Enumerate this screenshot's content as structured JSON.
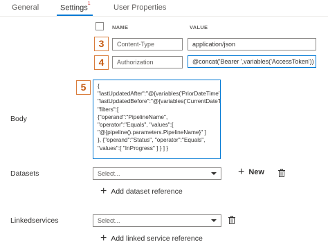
{
  "tabs": {
    "general": "General",
    "settings": "Settings",
    "settings_badge": "1",
    "user_properties": "User Properties"
  },
  "headers_table": {
    "col_name": "NAME",
    "col_value": "VALUE",
    "rows": [
      {
        "badge": "3",
        "name": "Content-Type",
        "value": "application/json"
      },
      {
        "badge": "4",
        "name": "Authorization",
        "value": "@concat('Bearer ',variables('AccessToken'))"
      }
    ]
  },
  "body": {
    "label": "Body",
    "badge": "5",
    "content": "{\n\"lastUpdatedAfter\":\"@{variables('PriorDateTime')}\",\n\"lastUpdatedBefore\":\"@{variables('CurrentDateTime')}\", \"filters\":[\n{\"operand\":\"PipelineName\",\n\"operator\":\"Equals\", \"values\":[\n\"@{pipeline().parameters.PipelineName}\" ]\n}, {\"operand\":\"Status\", \"operator\":\"Equals\",\n\"values\":[ \"InProgress\" ] } ] }"
  },
  "datasets": {
    "label": "Datasets",
    "select_value": "Select...",
    "new_label": "New",
    "add_label": "Add dataset reference"
  },
  "linkedservices": {
    "label": "Linkedservices",
    "select_value": "Select...",
    "add_label": "Add linked service reference"
  },
  "colors": {
    "accent": "#0078d4",
    "badge_border": "#d97b3a",
    "badge_text": "#c55a11"
  },
  "icons": [
    "checkbox-icon",
    "chevron-down-icon",
    "plus-icon",
    "trash-icon"
  ]
}
